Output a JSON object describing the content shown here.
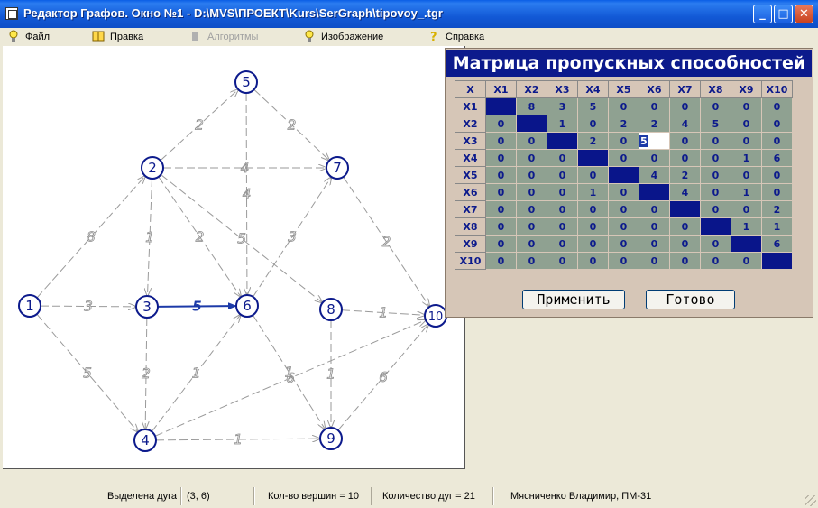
{
  "window": {
    "title": "Редактор Графов. Окно №1 - D:\\MVS\\ПРОЕКТ\\Kurs\\SerGraph\\tipovoy_.tgr",
    "minimize": "_",
    "maximize": "□",
    "close": "✕"
  },
  "menu": {
    "file": "Файл",
    "edit": "Правка",
    "algorithms": "Алгоритмы",
    "image": "Изображение",
    "help": "Справка"
  },
  "graph": {
    "nodes": [
      {
        "id": "1"
      },
      {
        "id": "2"
      },
      {
        "id": "3"
      },
      {
        "id": "4"
      },
      {
        "id": "5"
      },
      {
        "id": "6"
      },
      {
        "id": "7"
      },
      {
        "id": "8"
      },
      {
        "id": "9"
      },
      {
        "id": "10"
      }
    ],
    "edges": [
      {
        "from": "1",
        "to": "2",
        "w": "8"
      },
      {
        "from": "1",
        "to": "3",
        "w": "3"
      },
      {
        "from": "1",
        "to": "4",
        "w": "5"
      },
      {
        "from": "2",
        "to": "3",
        "w": "1"
      },
      {
        "from": "2",
        "to": "5",
        "w": "2"
      },
      {
        "from": "2",
        "to": "6",
        "w": "2"
      },
      {
        "from": "2",
        "to": "7",
        "w": "4"
      },
      {
        "from": "2",
        "to": "8",
        "w": "5"
      },
      {
        "from": "3",
        "to": "4",
        "w": "2"
      },
      {
        "from": "3",
        "to": "6",
        "w": "5",
        "selected": true
      },
      {
        "from": "4",
        "to": "6",
        "w": "1"
      },
      {
        "from": "4",
        "to": "9",
        "w": "1"
      },
      {
        "from": "4",
        "to": "10",
        "w": "6"
      },
      {
        "from": "5",
        "to": "6",
        "w": "4"
      },
      {
        "from": "5",
        "to": "7",
        "w": "2"
      },
      {
        "from": "6",
        "to": "7",
        "w": "3"
      },
      {
        "from": "6",
        "to": "9",
        "w": "1"
      },
      {
        "from": "7",
        "to": "10",
        "w": "2"
      },
      {
        "from": "8",
        "to": "9",
        "w": "1"
      },
      {
        "from": "8",
        "to": "10",
        "w": "1"
      },
      {
        "from": "9",
        "to": "10",
        "w": "6"
      }
    ]
  },
  "matrix": {
    "title": "Матрица пропускных способностей",
    "corner": "X",
    "headers": [
      "X1",
      "X2",
      "X3",
      "X4",
      "X5",
      "X6",
      "X7",
      "X8",
      "X9",
      "X10"
    ],
    "rows": [
      [
        "",
        "8",
        "3",
        "5",
        "0",
        "0",
        "0",
        "0",
        "0",
        "0"
      ],
      [
        "0",
        "",
        "1",
        "0",
        "2",
        "2",
        "4",
        "5",
        "0",
        "0"
      ],
      [
        "0",
        "0",
        "",
        "2",
        "0",
        "5",
        "0",
        "0",
        "0",
        "0"
      ],
      [
        "0",
        "0",
        "0",
        "",
        "0",
        "0",
        "0",
        "0",
        "1",
        "6"
      ],
      [
        "0",
        "0",
        "0",
        "0",
        "",
        "4",
        "2",
        "0",
        "0",
        "0"
      ],
      [
        "0",
        "0",
        "0",
        "1",
        "0",
        "",
        "4",
        "0",
        "1",
        "0"
      ],
      [
        "0",
        "0",
        "0",
        "0",
        "0",
        "0",
        "",
        "0",
        "0",
        "2"
      ],
      [
        "0",
        "0",
        "0",
        "0",
        "0",
        "0",
        "0",
        "",
        "1",
        "1"
      ],
      [
        "0",
        "0",
        "0",
        "0",
        "0",
        "0",
        "0",
        "0",
        "",
        "6"
      ],
      [
        "0",
        "0",
        "0",
        "0",
        "0",
        "0",
        "0",
        "0",
        "0",
        ""
      ]
    ],
    "editing": {
      "row": 2,
      "col": 5
    },
    "apply_button": "Применить",
    "done_button": "Готово"
  },
  "status": {
    "selected_label": "Выделена дуга",
    "selected_value": "(3, 6)",
    "vertex_count": "Кол-во вершин = 10",
    "edge_count": "Количество дуг = 21",
    "author": "Мясниченко Владимир, ПМ-31"
  },
  "colors": {
    "graph_line": "#9a9a9a",
    "node": "#0c1a8c",
    "selected_edge": "#1c3aa8",
    "matrix_cell": "#8fa191",
    "matrix_diag": "#09158a"
  }
}
